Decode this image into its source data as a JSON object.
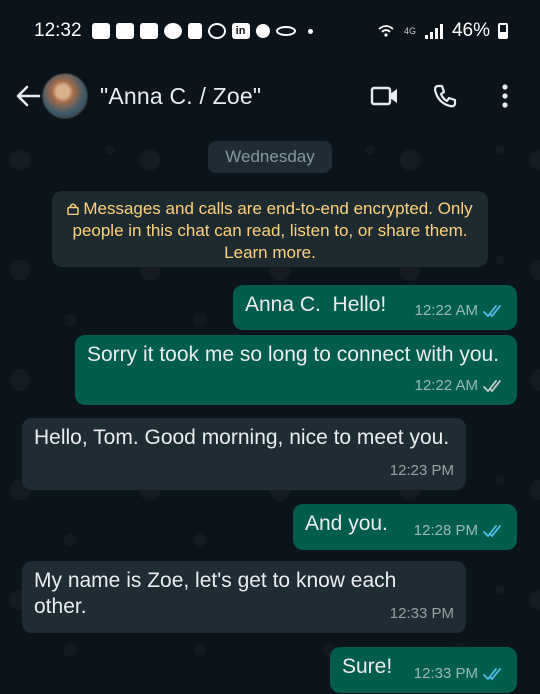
{
  "status_bar": {
    "time": "12:32",
    "network": "4G",
    "battery": "46%"
  },
  "header": {
    "contact_name": "\"Anna C. / Zoe\"",
    "icons": [
      "back-arrow-icon",
      "video-call-icon",
      "phone-call-icon",
      "more-vert-icon"
    ]
  },
  "chat": {
    "date_label": "Wednesday",
    "encryption_notice": "Messages and calls are end-to-end encrypted. Only people in this chat can read, listen to, or share them. Learn more.",
    "messages": [
      {
        "direction": "out",
        "text": "Anna C.  Hello!",
        "time": "12:22 AM",
        "status": "read"
      },
      {
        "direction": "out",
        "text": "Sorry it took me so long to connect with you.",
        "time": "12:22 AM",
        "status": "delivered"
      },
      {
        "direction": "in",
        "text": "Hello, Tom. Good morning, nice to meet you.",
        "time": "12:23 PM"
      },
      {
        "direction": "out",
        "text": "And you.",
        "time": "12:28 PM",
        "status": "read"
      },
      {
        "direction": "in",
        "text": "My name is Zoe, let's get to know each other.",
        "time": "12:33 PM"
      },
      {
        "direction": "out",
        "text": "Sure!",
        "time": "12:33 PM",
        "status": "read"
      }
    ]
  },
  "colors": {
    "background": "#0b141a",
    "outgoing_bubble": "#005c4b",
    "incoming_bubble": "#202c33",
    "encryption_text": "#ffd279",
    "read_tick": "#53bdeb"
  }
}
